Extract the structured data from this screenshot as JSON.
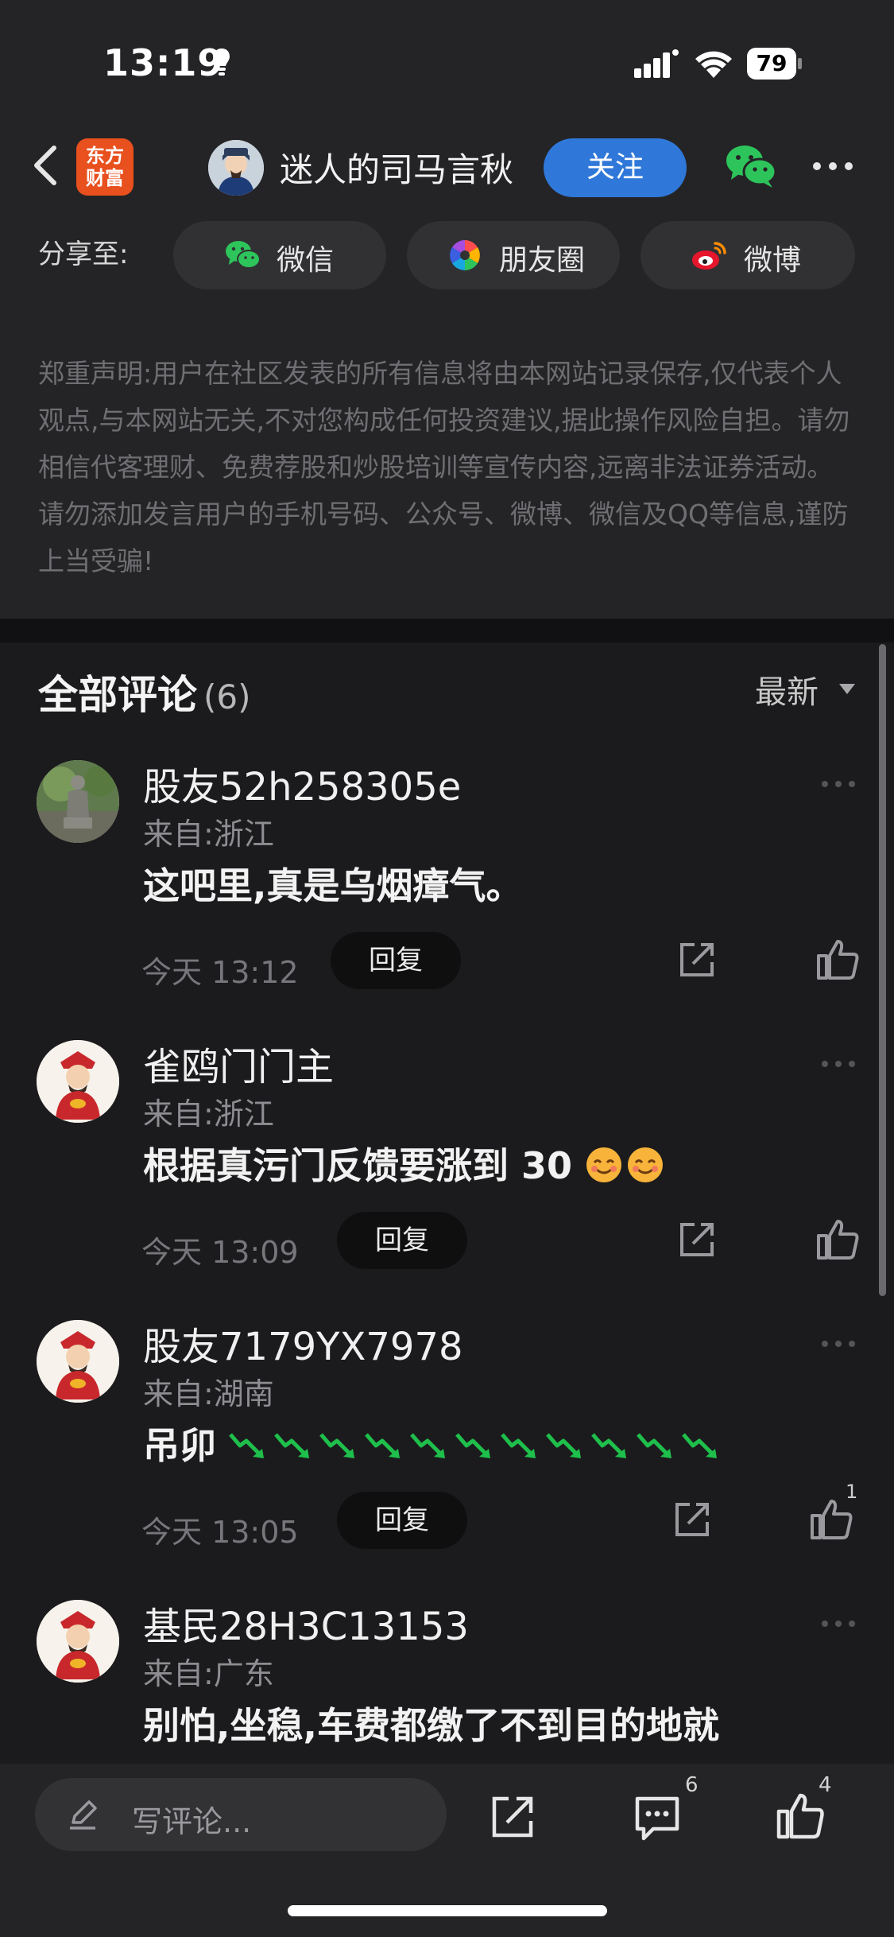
{
  "status_bar": {
    "time": "13:19",
    "battery": "79"
  },
  "nav": {
    "logo_line1": "东方",
    "logo_line2": "财富",
    "author_name": "迷人的司马言秋",
    "follow_label": "关注"
  },
  "share": {
    "label": "分享至:",
    "targets": [
      {
        "label": "微信",
        "icon": "wechat-icon"
      },
      {
        "label": "朋友圈",
        "icon": "moments-icon"
      },
      {
        "label": "微博",
        "icon": "weibo-icon"
      }
    ]
  },
  "disclaimer": "郑重声明:用户在社区发表的所有信息将由本网站记录保存,仅代表个人观点,与本网站无关,不对您构成任何投资建议,据此操作风险自担。请勿相信代客理财、免费荐股和炒股培训等宣传内容,远离非法证券活动。请勿添加发言用户的手机号码、公众号、微博、微信及QQ等信息,谨防上当受骗!",
  "comments_section": {
    "title": "全部评论",
    "count": "(6)",
    "sort": "最新",
    "items": [
      {
        "user": "股友52h258305e",
        "location": "来自:浙江",
        "text": "这吧里,真是乌烟瘴气。",
        "emoji": "",
        "time": "今天 13:12",
        "reply": "回复",
        "likes": "",
        "avatar": "statue-avatar"
      },
      {
        "user": "雀鸥门门主",
        "location": "来自:浙江",
        "text": "根据真污门反馈要涨到 30",
        "emoji": "😊😊",
        "time": "今天 13:09",
        "reply": "回复",
        "likes": "",
        "avatar": "fortune-god-avatar"
      },
      {
        "user": "股友7179YX7978",
        "location": "来自:湖南",
        "text": "吊卯",
        "emoji": "📉📉📉📉📉📉📉📉📉📉📉",
        "time": "今天 13:05",
        "reply": "回复",
        "likes": "1",
        "avatar": "fortune-god-avatar"
      },
      {
        "user": "基民28H3C13153",
        "location": "来自:广东",
        "text": "别怕,坐稳,车费都缴了不到目的地就",
        "emoji": "",
        "time": "",
        "reply": "",
        "likes": "",
        "avatar": "fortune-god-avatar"
      }
    ]
  },
  "bottom_bar": {
    "placeholder": "写评论...",
    "comment_count": "6",
    "like_count": "4"
  },
  "colors": {
    "background": "#1b1b1d",
    "panel": "#242426",
    "accent": "#2f78d9",
    "brand": "#e8501e",
    "wechat": "#2dc55b",
    "trend_down": "#1fbf4b"
  }
}
